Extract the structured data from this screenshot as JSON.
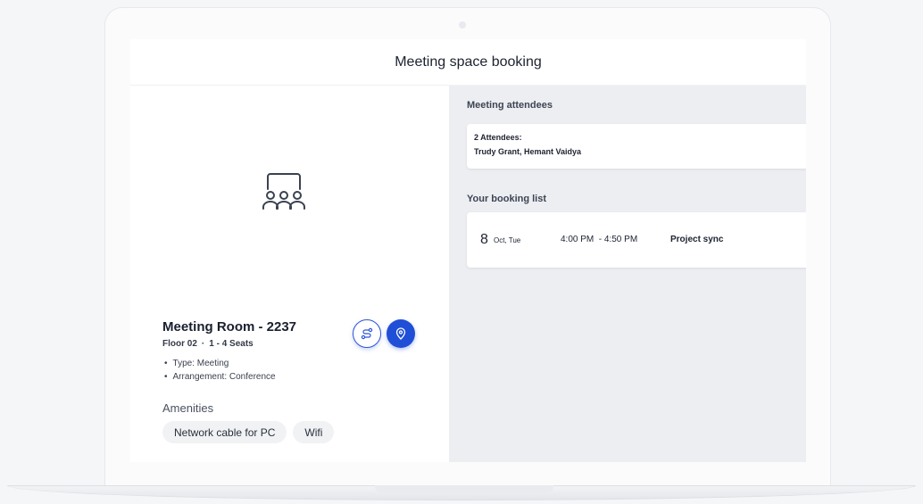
{
  "header": {
    "title": "Meeting space booking"
  },
  "room": {
    "icon": "meeting-room-icon",
    "name": "Meeting Room - 2237",
    "floor": "Floor 02",
    "seats": "1 - 4 Seats",
    "type": "Type: Meeting",
    "arrangement": "Arrangement: Conference",
    "amenities_title": "Amenities",
    "amenities": [
      "Network cable for PC",
      "Wifi"
    ]
  },
  "actions": {
    "route_icon": "route-icon",
    "location_icon": "location-pin-icon"
  },
  "attendees": {
    "section_title": "Meeting attendees",
    "count_label": "2 Attendees:",
    "names": "Trudy Grant, Hemant Vaidya"
  },
  "bookings": {
    "section_title": "Your booking list",
    "items": [
      {
        "day": "8",
        "date": "Oct, Tue",
        "time": "4:00 PM  - 4:50 PM",
        "title": "Project sync"
      }
    ]
  },
  "colors": {
    "accent": "#1f4fd6",
    "panel_bg": "#eceef2"
  }
}
